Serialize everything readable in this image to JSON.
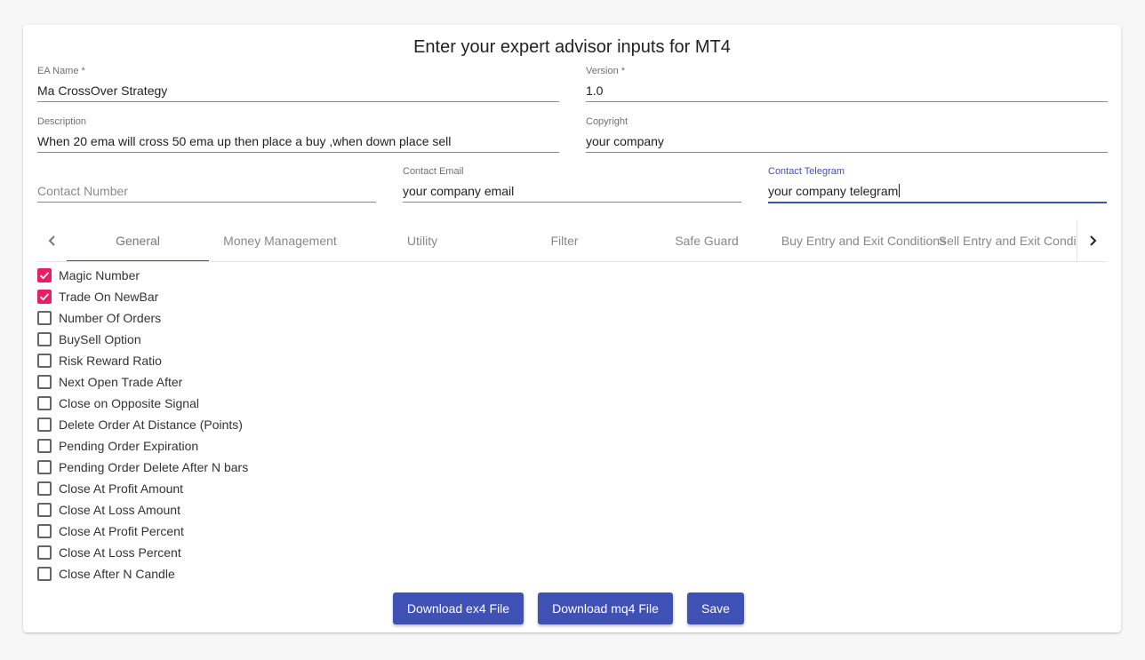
{
  "title": "Enter your expert advisor inputs for MT4",
  "fields": {
    "ea_name": {
      "label": "EA Name *",
      "value": "Ma CrossOver Strategy"
    },
    "version": {
      "label": "Version *",
      "value": "1.0"
    },
    "description": {
      "label": "Description",
      "value": "When 20 ema will cross 50 ema up  then place a buy ,when down place sell"
    },
    "copyright": {
      "label": "Copyright",
      "value": "your company"
    },
    "contact_number": {
      "placeholder": "Contact Number"
    },
    "contact_email": {
      "label": "Contact Email",
      "value": "your company email"
    },
    "contact_telegram": {
      "label": "Contact Telegram",
      "value": "your company telegram"
    }
  },
  "tabs": [
    {
      "label": "General",
      "active": true
    },
    {
      "label": "Money Management"
    },
    {
      "label": "Utility"
    },
    {
      "label": "Filter"
    },
    {
      "label": "Safe Guard"
    },
    {
      "label": "Buy Entry and Exit Conditions"
    },
    {
      "label": "Sell Entry and Exit Conditions"
    }
  ],
  "options": [
    {
      "label": "Magic Number",
      "checked": true
    },
    {
      "label": "Trade On NewBar",
      "checked": true
    },
    {
      "label": "Number Of Orders",
      "checked": false
    },
    {
      "label": "BuySell Option",
      "checked": false
    },
    {
      "label": "Risk Reward Ratio",
      "checked": false
    },
    {
      "label": "Next Open Trade After",
      "checked": false
    },
    {
      "label": "Close on Opposite Signal",
      "checked": false
    },
    {
      "label": "Delete Order At Distance (Points)",
      "checked": false
    },
    {
      "label": "Pending Order Expiration",
      "checked": false
    },
    {
      "label": "Pending Order Delete After N bars",
      "checked": false
    },
    {
      "label": "Close At Profit Amount",
      "checked": false
    },
    {
      "label": "Close At Loss Amount",
      "checked": false
    },
    {
      "label": "Close At Profit Percent",
      "checked": false
    },
    {
      "label": "Close At Loss Percent",
      "checked": false
    },
    {
      "label": "Close After N Candle",
      "checked": false
    }
  ],
  "buttons": {
    "download_ex4": "Download ex4 File",
    "download_mq4": "Download mq4 File",
    "save": "Save"
  },
  "colors": {
    "primary": "#3f51b5",
    "checkbox_checked": "#e91e63"
  },
  "icons": {
    "tab_prev": "chevron-left-icon",
    "tab_next": "chevron-right-icon",
    "checkbox_checked": "check-icon"
  }
}
